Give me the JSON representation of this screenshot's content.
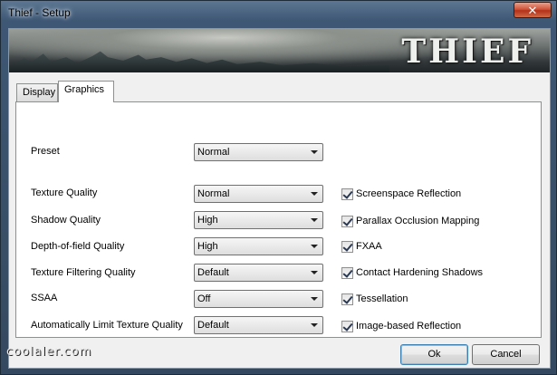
{
  "window": {
    "title": "Thief - Setup",
    "close_glyph": "✕",
    "logo_text": "THIEF"
  },
  "tabs": [
    {
      "label": "Display",
      "selected": false
    },
    {
      "label": "Graphics",
      "selected": true
    }
  ],
  "preset": {
    "label": "Preset",
    "value": "Normal"
  },
  "settings": [
    {
      "label": "Texture Quality",
      "value": "Normal"
    },
    {
      "label": "Shadow Quality",
      "value": "High"
    },
    {
      "label": "Depth-of-field Quality",
      "value": "High"
    },
    {
      "label": "Texture Filtering Quality",
      "value": "Default"
    },
    {
      "label": "SSAA",
      "value": "Off"
    },
    {
      "label": "Automatically Limit Texture Quality",
      "value": "Default"
    }
  ],
  "checkboxes": [
    {
      "label": "Screenspace Reflection",
      "checked": true
    },
    {
      "label": "Parallax Occlusion Mapping",
      "checked": true
    },
    {
      "label": "FXAA",
      "checked": true
    },
    {
      "label": "Contact Hardening Shadows",
      "checked": true
    },
    {
      "label": "Tessellation",
      "checked": true
    },
    {
      "label": "Image-based Reflection",
      "checked": true
    }
  ],
  "buttons": {
    "ok": "Ok",
    "cancel": "Cancel"
  },
  "watermark": "coolaler.com",
  "colors": {
    "close_button": "#c8442a",
    "ok_border": "#3c7fb1"
  }
}
